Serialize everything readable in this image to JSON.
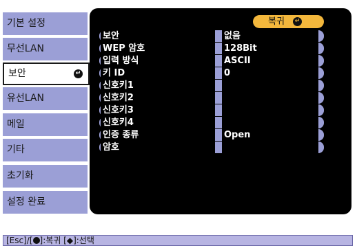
{
  "sidebar": {
    "items": [
      {
        "label": "기본 설정"
      },
      {
        "label": "무선LAN"
      },
      {
        "label": "보안"
      },
      {
        "label": "유선LAN"
      },
      {
        "label": "메일"
      },
      {
        "label": "기타"
      },
      {
        "label": "초기화"
      },
      {
        "label": "설정 완료"
      }
    ],
    "active_index": 2
  },
  "back_button": {
    "label": "복귀"
  },
  "settings": [
    {
      "key": "보안",
      "value": "없음"
    },
    {
      "key": "WEP 암호",
      "value": "128Bit"
    },
    {
      "key": "입력 방식",
      "value": "ASCII"
    },
    {
      "key": "키 ID",
      "value": "0"
    },
    {
      "key": "신호키1",
      "value": ""
    },
    {
      "key": "신호키2",
      "value": ""
    },
    {
      "key": "신호키3",
      "value": ""
    },
    {
      "key": "신호키4",
      "value": ""
    },
    {
      "key": "인증 종류",
      "value": "Open"
    },
    {
      "key": "암호",
      "value": ""
    }
  ],
  "footer": {
    "esc": "[Esc]",
    "enter_prefix": "/[",
    "enter_suffix": "]:복귀",
    "updown_key": "[◆]",
    "select": ":선택"
  },
  "colors": {
    "menu_bg": "#9b9fd6",
    "panel_bg": "#000000",
    "accent": "#f3b73c",
    "footer_bg": "#b7b4e2"
  }
}
